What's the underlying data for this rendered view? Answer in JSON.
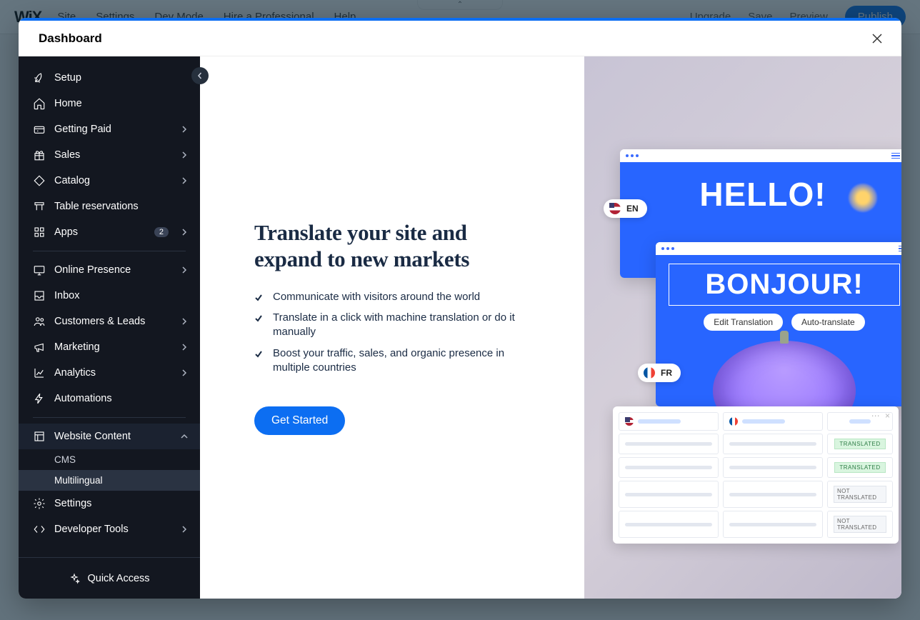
{
  "bg": {
    "logo": "WiX",
    "menu": [
      "Site",
      "Settings",
      "Dev Mode",
      "Hire a Professional",
      "Help"
    ],
    "upgrade": "Upgrade",
    "save": "Save",
    "preview": "Preview",
    "publish": "Publish"
  },
  "modal": {
    "title": "Dashboard"
  },
  "sidebar": {
    "items": [
      {
        "icon": "rocket",
        "label": "Setup"
      },
      {
        "icon": "home",
        "label": "Home"
      },
      {
        "icon": "money",
        "label": "Getting Paid",
        "chevron": true
      },
      {
        "icon": "gift",
        "label": "Sales",
        "chevron": true
      },
      {
        "icon": "tag",
        "label": "Catalog",
        "chevron": true
      },
      {
        "icon": "table",
        "label": "Table reservations"
      },
      {
        "icon": "apps",
        "label": "Apps",
        "badge": "2",
        "chevron": true
      }
    ],
    "items2": [
      {
        "icon": "monitor",
        "label": "Online Presence",
        "chevron": true
      },
      {
        "icon": "inbox",
        "label": "Inbox"
      },
      {
        "icon": "people",
        "label": "Customers & Leads",
        "chevron": true
      },
      {
        "icon": "mega",
        "label": "Marketing",
        "chevron": true
      },
      {
        "icon": "chart",
        "label": "Analytics",
        "chevron": true
      },
      {
        "icon": "bolt",
        "label": "Automations"
      }
    ],
    "webcontent": {
      "label": "Website Content",
      "open": true
    },
    "subs": [
      {
        "label": "CMS"
      },
      {
        "label": "Multilingual",
        "active": true
      }
    ],
    "items3": [
      {
        "icon": "gear",
        "label": "Settings"
      },
      {
        "icon": "code",
        "label": "Developer Tools",
        "chevron": true
      }
    ],
    "footer": {
      "label": "Quick Access"
    }
  },
  "content": {
    "heading": "Translate your site and expand to new markets",
    "bullets": [
      "Communicate with visitors around the world",
      "Translate in a click with machine translation or do it manually",
      "Boost your traffic, sales, and organic presence in multiple countries"
    ],
    "cta": "Get Started"
  },
  "illus": {
    "hello": "HELLO!",
    "bonjour": "BONJOUR!",
    "en": "EN",
    "fr": "FR",
    "edit": "Edit Translation",
    "auto": "Auto-translate",
    "translated": "TRANSLATED",
    "not_translated": "NOT TRANSLATED"
  }
}
